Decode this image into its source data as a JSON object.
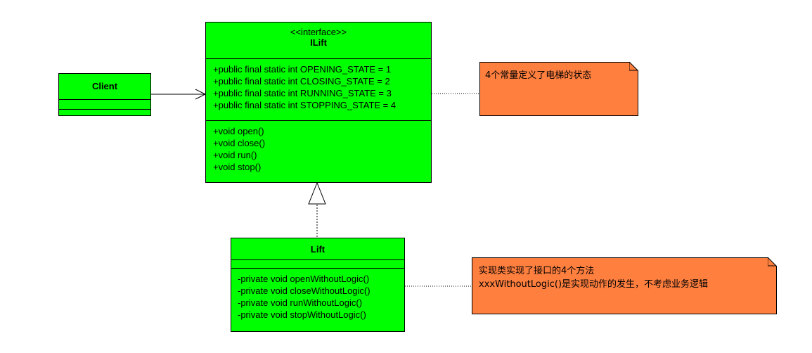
{
  "client": {
    "name": "Client"
  },
  "ilift": {
    "stereotype": "<<interface>>",
    "name": "ILift",
    "attributes": [
      "+public final static int OPENING_STATE = 1",
      "+public final static int CLOSING_STATE = 2",
      "+public final static int RUNNING_STATE = 3",
      "+public final static int STOPPING_STATE = 4"
    ],
    "methods": [
      "+void open()",
      "+void close()",
      "+void run()",
      "+void stop()"
    ]
  },
  "lift": {
    "name": "Lift",
    "methods": [
      "-private void openWithoutLogic()",
      "-private void closeWithoutLogic()",
      "-private void runWithoutLogic()",
      "-private void stopWithoutLogic()"
    ]
  },
  "notes": {
    "constants": "4个常量定义了电梯的状态",
    "impl_line1": "实现类实现了接口的4个方法",
    "impl_line2": "xxxWithoutLogic()是实现动作的发生，不考虑业务逻辑"
  },
  "colors": {
    "class_fill": "#00ff00",
    "note_fill": "#ff7f3f",
    "line": "#000000"
  }
}
